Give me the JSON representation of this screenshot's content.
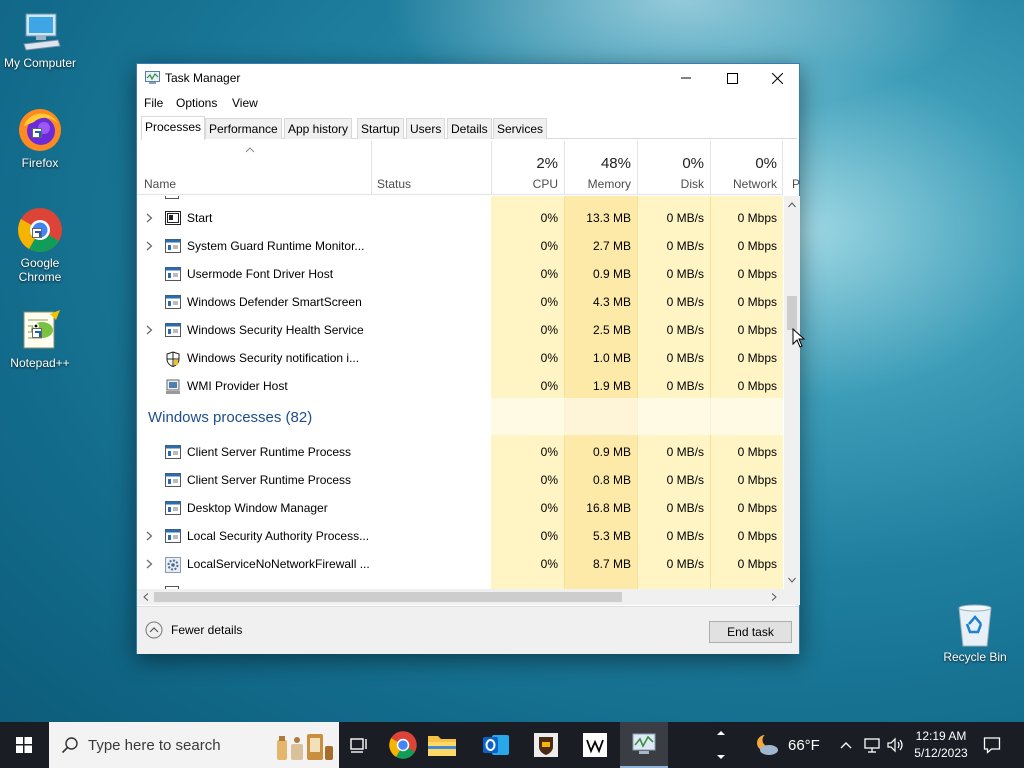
{
  "desktop": {
    "icons": [
      {
        "label": "My Computer"
      },
      {
        "label": "Firefox"
      },
      {
        "label": "Google Chrome"
      },
      {
        "label": "Notepad++"
      },
      {
        "label": "Recycle Bin"
      }
    ]
  },
  "window": {
    "title": "Task Manager",
    "menu": [
      "File",
      "Options",
      "View"
    ],
    "tabs": [
      "Processes",
      "Performance",
      "App history",
      "Startup",
      "Users",
      "Details",
      "Services"
    ],
    "active_tab": "Processes",
    "columns": {
      "name": "Name",
      "status": "Status",
      "cpu": {
        "pct": "2%",
        "label": "CPU"
      },
      "memory": {
        "pct": "48%",
        "label": "Memory"
      },
      "disk": {
        "pct": "0%",
        "label": "Disk"
      },
      "network": {
        "pct": "0%",
        "label": "Network"
      },
      "power_cut": "P"
    },
    "app_rows": [
      {
        "name": "Start",
        "cpu": "0%",
        "memory": "13.3 MB",
        "disk": "0 MB/s",
        "network": "0 Mbps",
        "expandable": true,
        "icon": "start-window-icon"
      },
      {
        "name": "System Guard Runtime Monitor...",
        "cpu": "0%",
        "memory": "2.7 MB",
        "disk": "0 MB/s",
        "network": "0 Mbps",
        "expandable": true,
        "icon": "service-window-icon"
      },
      {
        "name": "Usermode Font Driver Host",
        "cpu": "0%",
        "memory": "0.9 MB",
        "disk": "0 MB/s",
        "network": "0 Mbps",
        "expandable": false,
        "icon": "service-window-icon"
      },
      {
        "name": "Windows Defender SmartScreen",
        "cpu": "0%",
        "memory": "4.3 MB",
        "disk": "0 MB/s",
        "network": "0 Mbps",
        "expandable": false,
        "icon": "service-window-icon"
      },
      {
        "name": "Windows Security Health Service",
        "cpu": "0%",
        "memory": "2.5 MB",
        "disk": "0 MB/s",
        "network": "0 Mbps",
        "expandable": true,
        "icon": "service-window-icon"
      },
      {
        "name": "Windows Security notification i...",
        "cpu": "0%",
        "memory": "1.0 MB",
        "disk": "0 MB/s",
        "network": "0 Mbps",
        "expandable": false,
        "icon": "shield-icon"
      },
      {
        "name": "WMI Provider Host",
        "cpu": "0%",
        "memory": "1.9 MB",
        "disk": "0 MB/s",
        "network": "0 Mbps",
        "expandable": false,
        "icon": "wmi-icon"
      }
    ],
    "group_title": "Windows processes (82)",
    "windows_rows": [
      {
        "name": "Client Server Runtime Process",
        "cpu": "0%",
        "memory": "0.9 MB",
        "disk": "0 MB/s",
        "network": "0 Mbps",
        "expandable": false,
        "icon": "service-window-icon"
      },
      {
        "name": "Client Server Runtime Process",
        "cpu": "0%",
        "memory": "0.8 MB",
        "disk": "0 MB/s",
        "network": "0 Mbps",
        "expandable": false,
        "icon": "service-window-icon"
      },
      {
        "name": "Desktop Window Manager",
        "cpu": "0%",
        "memory": "16.8 MB",
        "disk": "0 MB/s",
        "network": "0 Mbps",
        "expandable": false,
        "icon": "service-window-icon"
      },
      {
        "name": "Local Security Authority Process...",
        "cpu": "0%",
        "memory": "5.3 MB",
        "disk": "0 MB/s",
        "network": "0 Mbps",
        "expandable": true,
        "icon": "service-window-icon"
      },
      {
        "name": "LocalServiceNoNetworkFirewall ...",
        "cpu": "0%",
        "memory": "8.7 MB",
        "disk": "0 MB/s",
        "network": "0 Mbps",
        "expandable": true,
        "icon": "gear-service-icon"
      }
    ],
    "footer": {
      "fewer_details": "Fewer details",
      "end_task": "End task"
    }
  },
  "taskbar": {
    "search_placeholder": "Type here to search",
    "weather": "66°F",
    "time": "12:19 AM",
    "date": "5/12/2023"
  }
}
